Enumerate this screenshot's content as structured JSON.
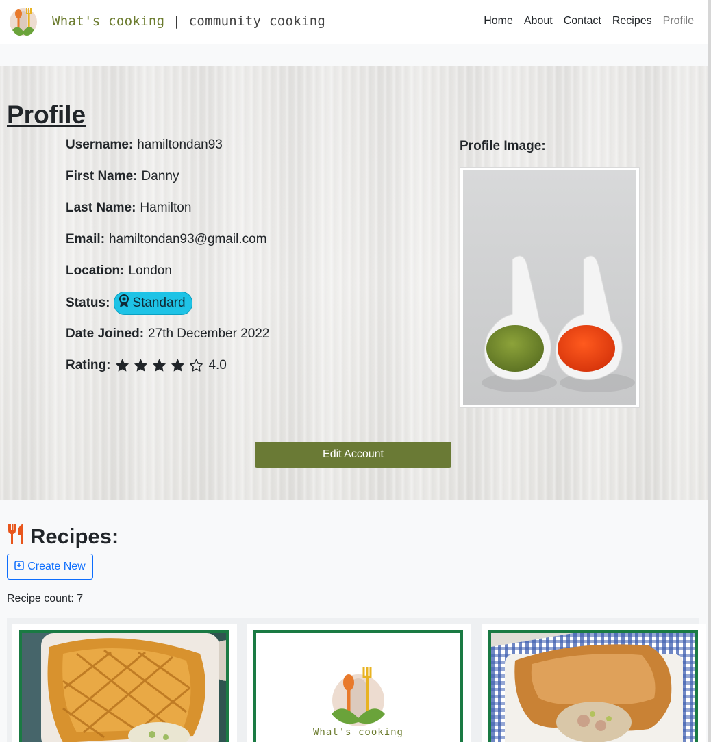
{
  "nav": {
    "brand": "What's cooking",
    "separator": "|",
    "subtitle": "community cooking",
    "links": [
      "Home",
      "About",
      "Contact",
      "Recipes",
      "Profile"
    ],
    "active": "Profile"
  },
  "profile": {
    "title": "Profile",
    "fields": {
      "username": {
        "label": "Username:",
        "value": "hamiltondan93"
      },
      "first_name": {
        "label": "First Name:",
        "value": "Danny"
      },
      "last_name": {
        "label": "Last Name:",
        "value": "Hamilton"
      },
      "email": {
        "label": "Email:",
        "value": "hamiltondan93@gmail.com"
      },
      "location": {
        "label": "Location:",
        "value": "London"
      },
      "status": {
        "label": "Status:",
        "value": "Standard"
      },
      "date_joined": {
        "label": "Date Joined:",
        "value": "27th December 2022"
      },
      "rating": {
        "label": "Rating:",
        "value": "4.0",
        "stars_filled": 4,
        "stars_total": 5
      }
    },
    "image_label": "Profile Image:",
    "edit_button": "Edit Account"
  },
  "recipes": {
    "title": "Recipes:",
    "create_button": "Create New",
    "count_text": "Recipe count: 7",
    "placeholder_logo_text": "What's cooking"
  },
  "colors": {
    "brand_green": "#6a7a35",
    "card_border": "#1a7a43",
    "badge": "#1ec3e6",
    "link_blue": "#0d6efd",
    "icon_orange": "#e8561c"
  },
  "icons": [
    "award-icon",
    "star-icon",
    "star-outline-icon",
    "utensils-icon",
    "plus-square-icon"
  ]
}
